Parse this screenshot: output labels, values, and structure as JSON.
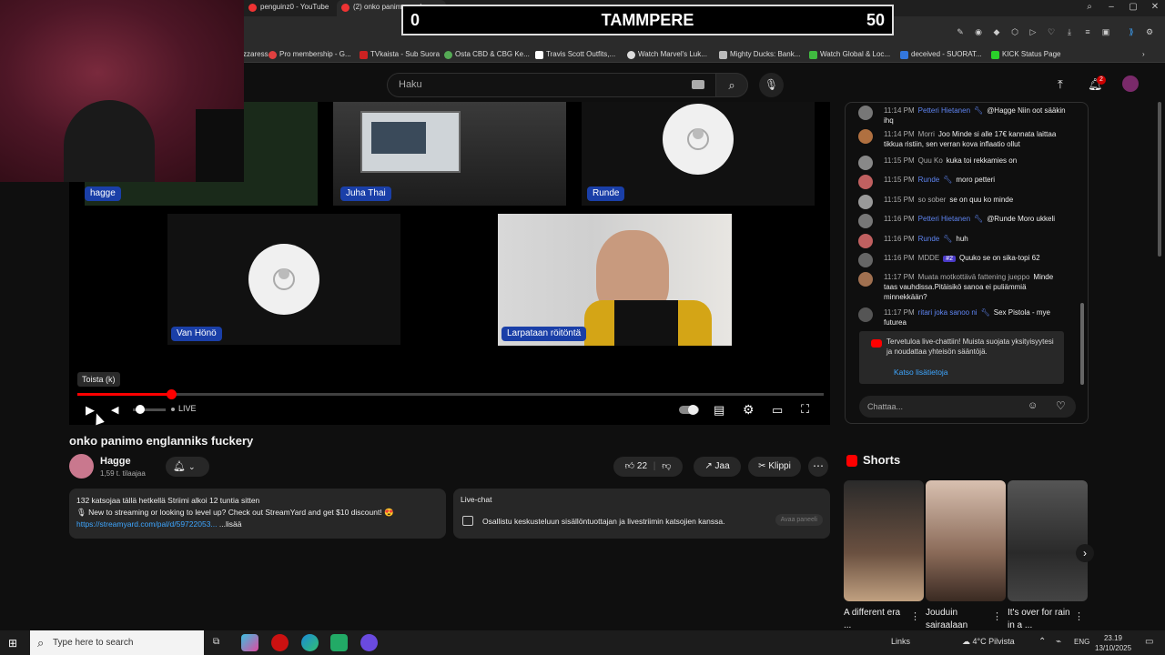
{
  "browser": {
    "tabs": [
      {
        "title": "penguinz0 - YouTube"
      },
      {
        "title": "(2) onko panimo englan..."
      }
    ],
    "bookmarks": [
      {
        "label": "zzaress",
        "color": "#f0a020"
      },
      {
        "label": "Pro membership - G...",
        "color": "#e04040"
      },
      {
        "label": "TVkaista - Sub Suora",
        "color": "#cc2222"
      },
      {
        "label": "Osta CBD & CBG Ke...",
        "color": "#55aa55"
      },
      {
        "label": "Travis Scott Outfits,...",
        "color": "#ffffff"
      },
      {
        "label": "Watch Marvel's Luk...",
        "color": "#dddddd"
      },
      {
        "label": "Mighty Ducks: Bank...",
        "color": "#bbbbbb"
      },
      {
        "label": "Watch Global & Loc...",
        "color": "#40bb40"
      },
      {
        "label": "deceived - SUORAT...",
        "color": "#3377dd"
      },
      {
        "label": "KICK Status Page",
        "color": "#2ad02a"
      }
    ]
  },
  "scoreboard": {
    "left_score": "0",
    "team": "TAMMPERE",
    "right_score": "50"
  },
  "header": {
    "search_placeholder": "Haku",
    "notifications_count": "2"
  },
  "video": {
    "participants": [
      {
        "name": "hagge"
      },
      {
        "name": "Juha Thai"
      },
      {
        "name": "Runde"
      },
      {
        "name": "Van Hönö"
      },
      {
        "name": "Larpataan röitöntä"
      }
    ],
    "tooltip": "Toista (k)",
    "live_label": "LIVE",
    "progress_fraction": 0.125
  },
  "meta": {
    "title": "onko panimo englanniks fuckery",
    "channel_name": "Hagge",
    "subscribers": "1,59 t. tilaajaa",
    "likes": "22",
    "share_label": "Jaa",
    "clip_label": "Klippi"
  },
  "description": {
    "line1": "132 katsojaa tällä hetkellä  Striimi alkoi 12 tuntia sitten",
    "line2": "🎙 New to streaming or looking to level up? Check out StreamYard and get $10 discount! 😍",
    "link": "https://streamyard.com/pal/d/59722053...",
    "more": "...lisää"
  },
  "livechat_box": {
    "title": "Live-chat",
    "text": "Osallistu keskusteluun sisällöntuottajan ja livestriimin katsojien kanssa.",
    "button": "Avaa paneeli"
  },
  "chat": {
    "messages": [
      {
        "time": "11:14 PM",
        "author": "Petteri Hietanen",
        "mod": true,
        "badge": "",
        "text": "@Hagge Niin oot sääkin ihq",
        "avatar": "#777777"
      },
      {
        "time": "11:14 PM",
        "author": "Morri",
        "mod": false,
        "badge": "",
        "text": "Joo Minde si alle 17€ kannata laittaa tikkua ristiin, sen verran kova inflaatio ollut",
        "avatar": "#b07040"
      },
      {
        "time": "11:15 PM",
        "author": "Quu Ko",
        "mod": false,
        "badge": "",
        "text": "kuka toi rekkamies on",
        "avatar": "#888888"
      },
      {
        "time": "11:15 PM",
        "author": "Runde",
        "mod": true,
        "badge": "",
        "text": "moro petteri",
        "avatar": "#c06060"
      },
      {
        "time": "11:15 PM",
        "author": "so sober",
        "mod": false,
        "badge": "",
        "text": "se on quu ko minde",
        "avatar": "#999999"
      },
      {
        "time": "11:16 PM",
        "author": "Petteri Hietanen",
        "mod": true,
        "badge": "",
        "text": "@Runde Moro ukkeli",
        "avatar": "#777777"
      },
      {
        "time": "11:16 PM",
        "author": "Runde",
        "mod": true,
        "badge": "",
        "text": "huh",
        "avatar": "#c06060"
      },
      {
        "time": "11:16 PM",
        "author": "MDDE",
        "mod": false,
        "badge": "#2",
        "text": "Quuko se on sika-topi 62",
        "avatar": "#666666"
      },
      {
        "time": "11:17 PM",
        "author": "Muata motkottävä fattening jueppo",
        "mod": false,
        "badge": "",
        "text": "Minde taas vauhdissa.Pitäisikö sanoa ei puliämmiä minnekkään?",
        "avatar": "#a07050"
      },
      {
        "time": "11:17 PM",
        "author": "ritari joka sanoo ni",
        "mod": true,
        "badge": "",
        "text": "Sex Pistola - mye futurea",
        "avatar": "#555555"
      }
    ],
    "welcome_text": "Tervetuloa live-chattiin! Muista suojata yksityisyytesi ja noudattaa yhteisön sääntöjä.",
    "welcome_link": "Katso lisätietoja",
    "input_placeholder": "Chattaa..."
  },
  "shorts": {
    "title": "Shorts",
    "items": [
      {
        "caption": "A different era ...",
        "color": "#5a4636"
      },
      {
        "caption": "Jouduin sairaalaan",
        "color": "#8a6a58"
      },
      {
        "caption": "It's over for rain in a ...",
        "color": "#3a3a3a"
      }
    ]
  },
  "taskbar": {
    "search_placeholder": "Type here to search",
    "links": "Links",
    "weather": "4°C  Pilvista",
    "lang": "ENG",
    "time": "23.19",
    "date": "13/10/2025"
  }
}
